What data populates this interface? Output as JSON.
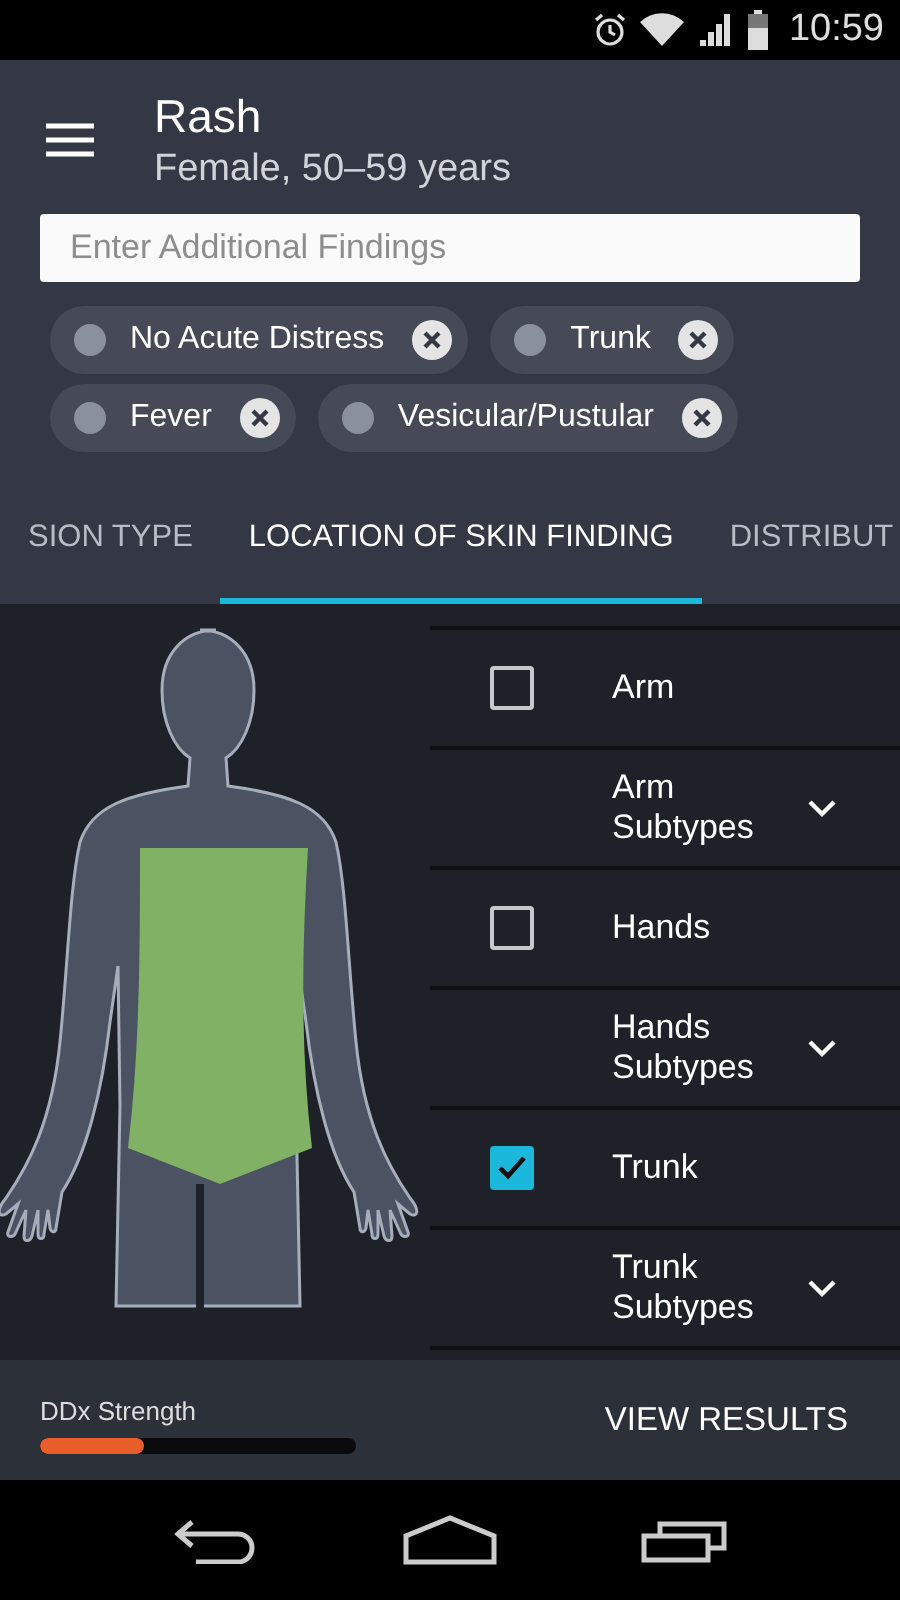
{
  "status_bar": {
    "time": "10:59"
  },
  "header": {
    "title": "Rash",
    "subtitle": "Female, 50–59 years"
  },
  "search": {
    "placeholder": "Enter Additional Findings"
  },
  "chips": [
    {
      "label": "No Acute Distress"
    },
    {
      "label": "Trunk"
    },
    {
      "label": "Fever"
    },
    {
      "label": "Vesicular/Pustular"
    }
  ],
  "tabs": [
    {
      "label": "SION TYPE",
      "selected": false
    },
    {
      "label": "LOCATION OF SKIN FINDING",
      "selected": true
    },
    {
      "label": "DISTRIBUT",
      "selected": false
    }
  ],
  "locations": [
    {
      "kind": "checkbox",
      "label": "Arm",
      "checked": false
    },
    {
      "kind": "subtypes",
      "label": "Arm Subtypes",
      "expanded": false
    },
    {
      "kind": "checkbox",
      "label": "Hands",
      "checked": false
    },
    {
      "kind": "subtypes",
      "label": "Hands Subtypes",
      "expanded": false
    },
    {
      "kind": "checkbox",
      "label": "Trunk",
      "checked": true
    },
    {
      "kind": "subtypes",
      "label": "Trunk Subtypes",
      "expanded": false
    }
  ],
  "footer": {
    "strength_label": "DDx Strength",
    "level": 0.33,
    "button": "VIEW RESULTS"
  }
}
